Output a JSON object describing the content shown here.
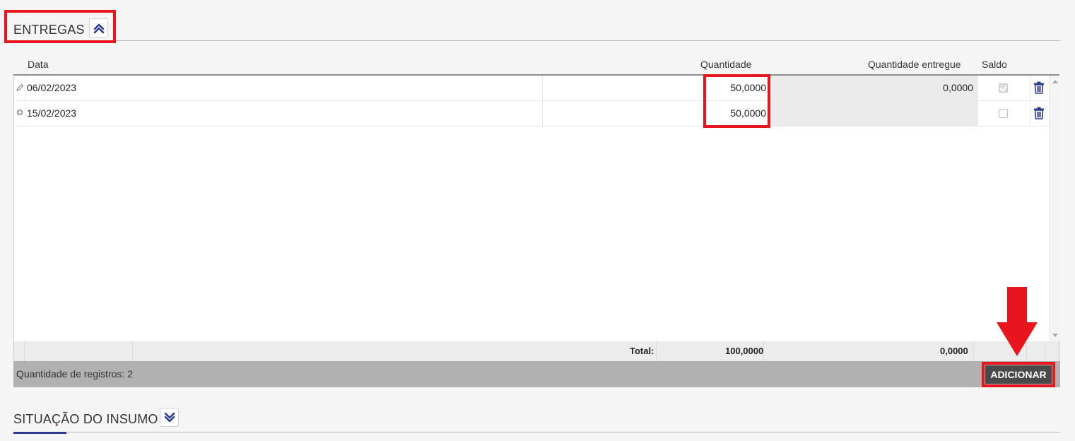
{
  "sections": {
    "entregas": {
      "title": "ENTREGAS",
      "toggle_icon": "double-chevron-up-icon",
      "expanded": true
    },
    "situacao": {
      "title": "SITUAÇÃO DO INSUMO",
      "toggle_icon": "double-chevron-down-icon",
      "expanded": false
    }
  },
  "grid": {
    "columns": {
      "data": "Data",
      "quantidade": "Quantidade",
      "quantidade_entregue": "Quantidade entregue",
      "saldo": "Saldo"
    },
    "rows": [
      {
        "state_icon": "pencil-icon",
        "data": "06/02/2023",
        "quantidade": "50,0000",
        "quantidade_entregue": "0,0000",
        "saldo_checked": true
      },
      {
        "state_icon": "plus-icon",
        "data": "15/02/2023",
        "quantidade": "50,0000",
        "quantidade_entregue": "",
        "saldo_checked": false
      }
    ],
    "totals": {
      "label": "Total:",
      "quantidade": "100,0000",
      "quantidade_entregue": "0,0000"
    },
    "footer": {
      "records_label": "Quantidade de registros:",
      "records_count": "2",
      "add_button": "ADICIONAR"
    }
  },
  "colors": {
    "accent": "#2b3a8c",
    "highlight": "#e8141e",
    "trash": "#2b3a8c",
    "footer_bar": "#b1b1b1",
    "button": "#4a4a4a"
  }
}
